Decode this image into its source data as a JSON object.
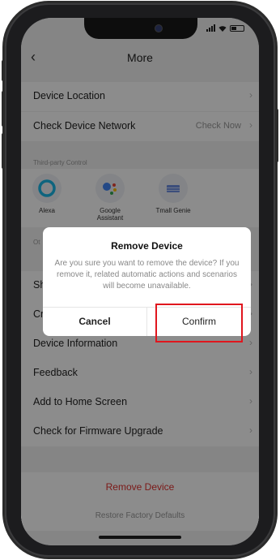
{
  "nav": {
    "back_icon": "chevron-left",
    "title": "More"
  },
  "list1": [
    {
      "label": "Device Location",
      "right": ""
    },
    {
      "label": "Check Device Network",
      "right": "Check Now"
    }
  ],
  "third_party": {
    "header": "Third-party Control",
    "items": [
      {
        "label": "Alexa",
        "icon": "alexa-icon",
        "color": "#1ab7e6"
      },
      {
        "label": "Google Assistant",
        "icon": "google-assistant-icon",
        "color": "#4285f4"
      },
      {
        "label": "Tmall Genie",
        "icon": "tmall-genie-icon",
        "color": "#3c6fd6"
      }
    ]
  },
  "other_header": "Ot",
  "list2": [
    {
      "label": "Sh"
    },
    {
      "label": "Cr"
    },
    {
      "label": "Device Information"
    },
    {
      "label": "Feedback"
    },
    {
      "label": "Add to Home Screen"
    },
    {
      "label": "Check for Firmware Upgrade"
    }
  ],
  "remove_device": "Remove Device",
  "restore_defaults": "Restore Factory Defaults",
  "dialog": {
    "title": "Remove Device",
    "message": "Are you sure you want to remove the device? If you remove it, related automatic actions and scenarios will become unavailable.",
    "cancel": "Cancel",
    "confirm": "Confirm"
  },
  "colors": {
    "danger": "#e0312f",
    "highlight": "#e0161e"
  }
}
